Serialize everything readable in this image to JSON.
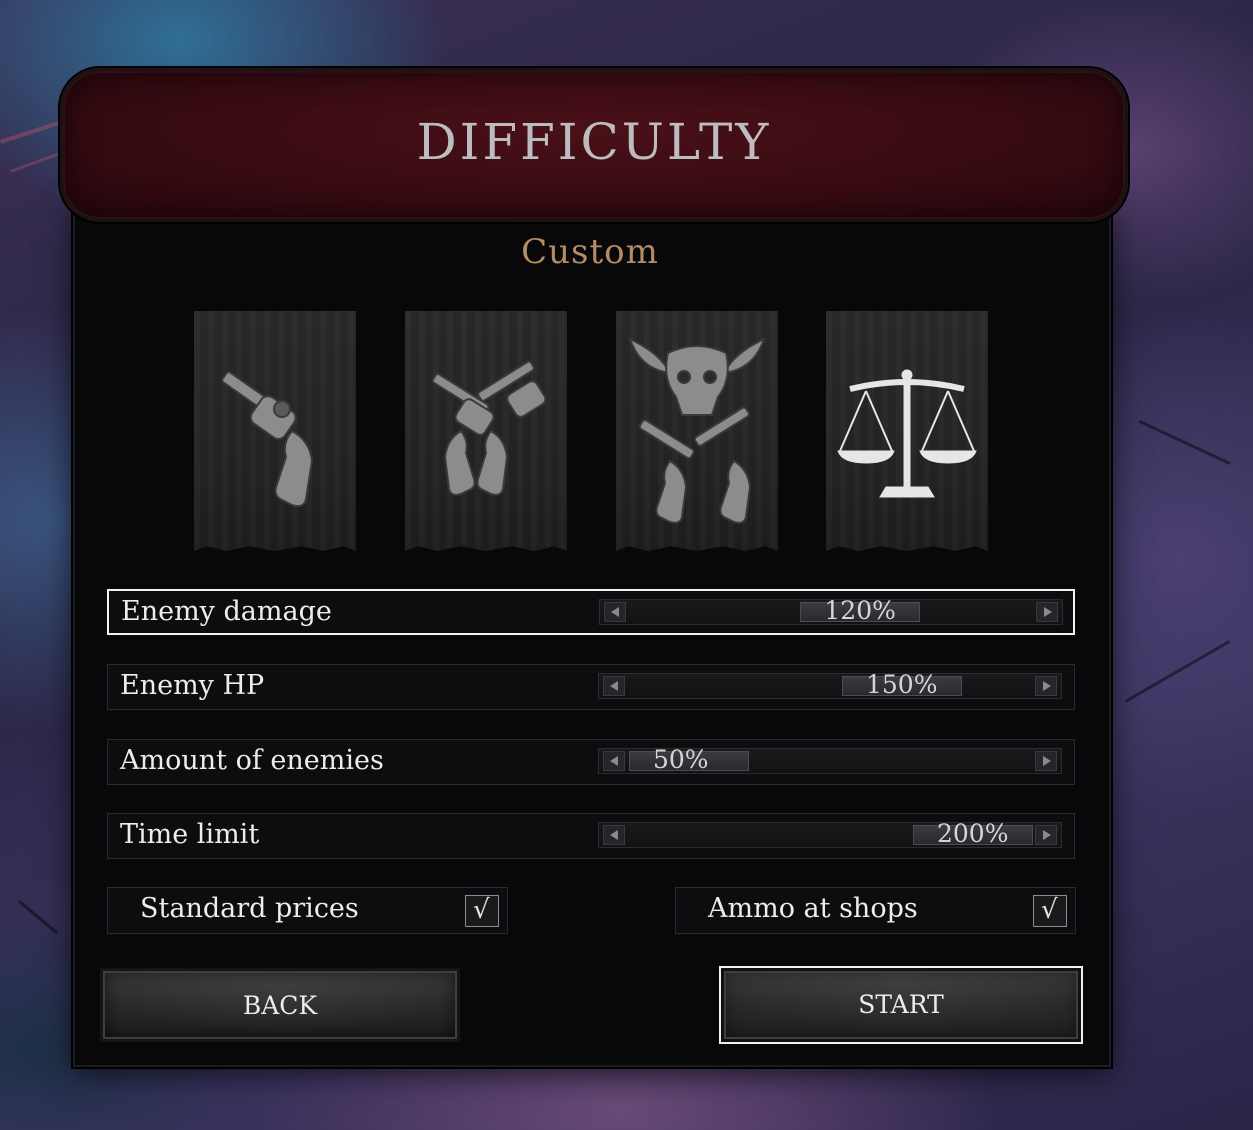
{
  "header": {
    "title": "DIFFICULTY"
  },
  "preset": {
    "name": "Custom"
  },
  "difficulty_banners": [
    {
      "icon": "single-revolver-icon"
    },
    {
      "icon": "crossed-revolvers-icon"
    },
    {
      "icon": "bull-skull-crossed-revolvers-icon"
    },
    {
      "icon": "scales-icon",
      "selected": true
    }
  ],
  "settings": [
    {
      "label": "Enemy damage",
      "value": "120%",
      "level": 0.6,
      "selected": true
    },
    {
      "label": "Enemy HP",
      "value": "150%",
      "level": 0.75
    },
    {
      "label": "Amount of enemies",
      "value": "50%",
      "level": 0.0
    },
    {
      "label": "Time limit",
      "value": "200%",
      "level": 1.0
    }
  ],
  "toggles": [
    {
      "label": "Standard prices",
      "checked": true,
      "mark": "√"
    },
    {
      "label": "Ammo at shops",
      "checked": true,
      "mark": "√"
    }
  ],
  "buttons": {
    "back": "BACK",
    "start": "START"
  },
  "colors": {
    "header": "#3d0c13",
    "subtitle": "#b58c61",
    "panel": "#08080a"
  }
}
